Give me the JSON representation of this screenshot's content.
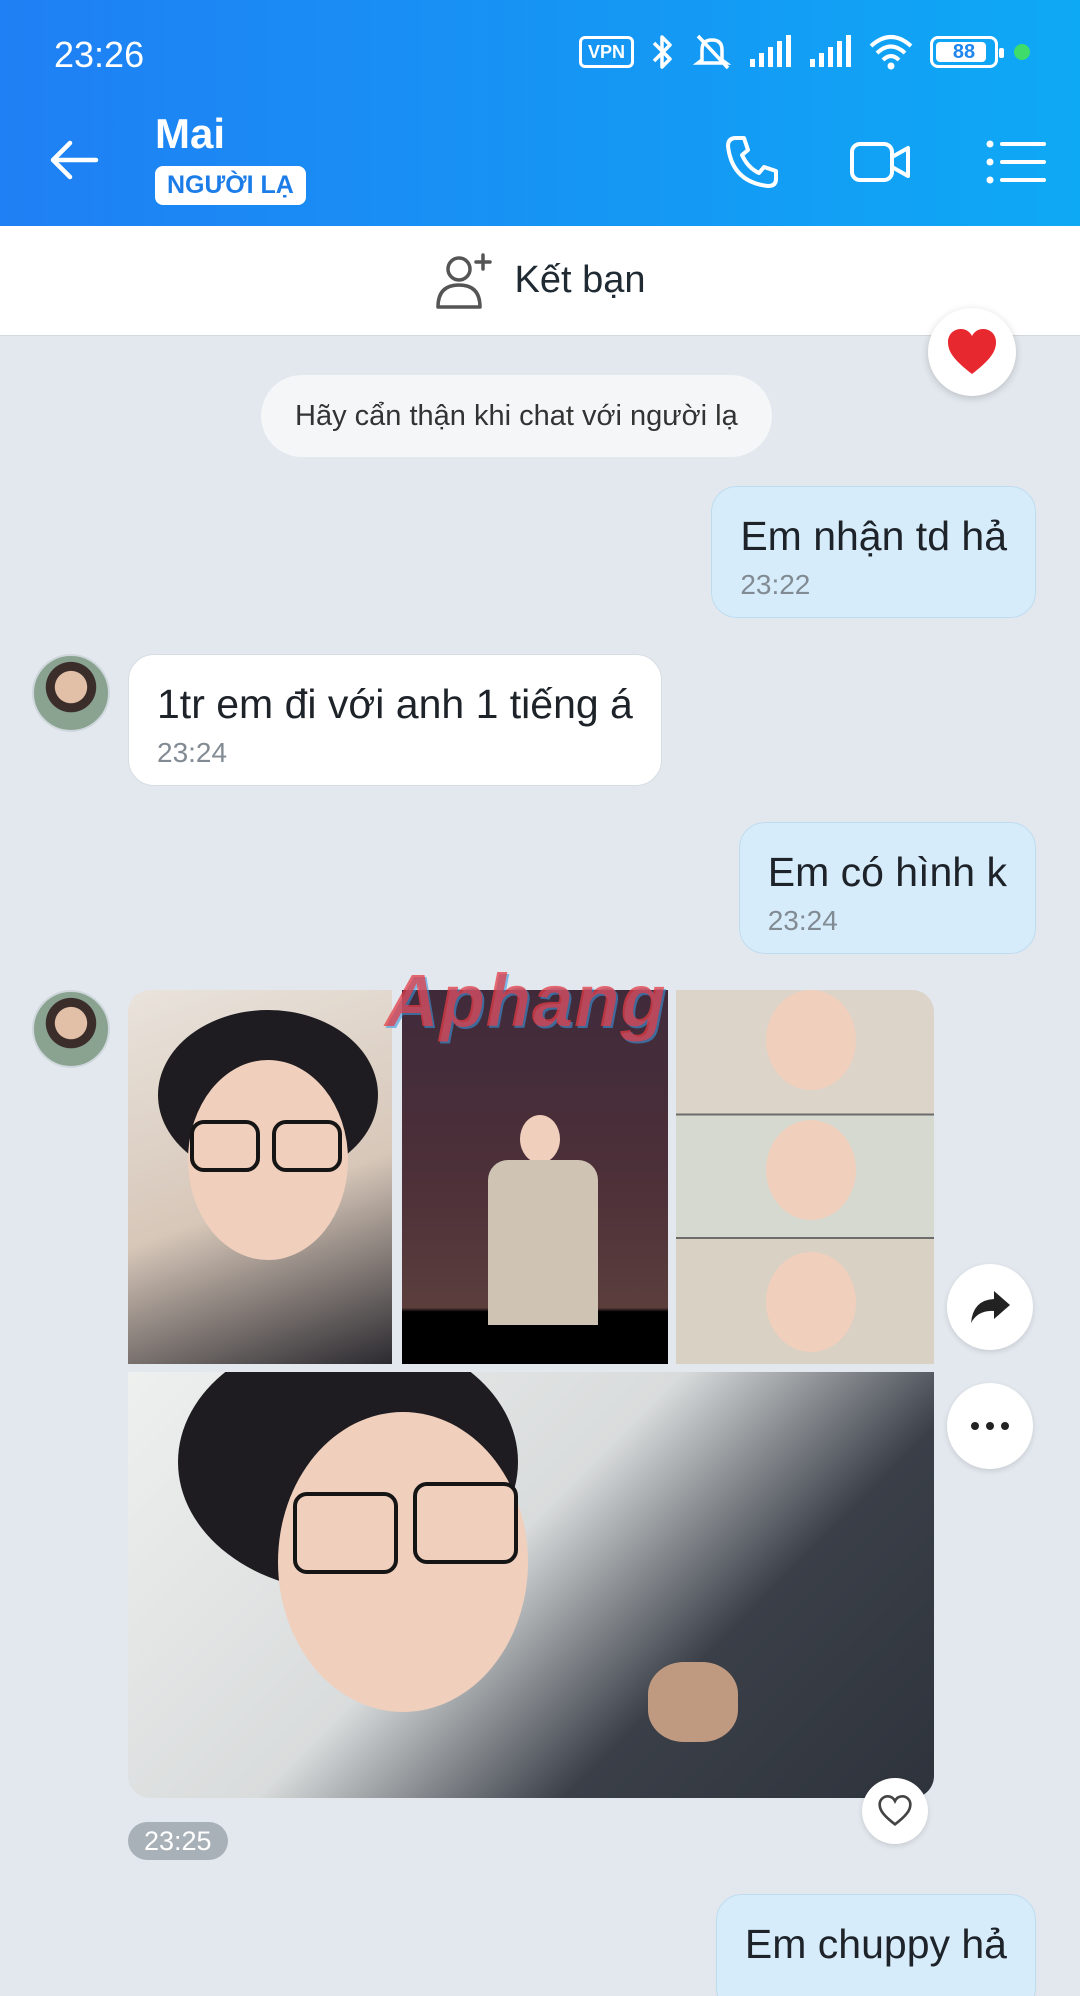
{
  "status_bar": {
    "time": "23:26",
    "vpn": "VPN",
    "battery": "88"
  },
  "header": {
    "contact_name": "Mai",
    "badge": "NGƯỜI LẠ",
    "icons": [
      "back-arrow-icon",
      "phone-icon",
      "video-camera-icon",
      "menu-list-icon"
    ]
  },
  "add_friend": {
    "label": "Kết bạn",
    "icon": "add-person-icon"
  },
  "system_note": "Hãy cẩn thận khi chat với người lạ",
  "messages": [
    {
      "side": "out",
      "text": "Em nhận td hả",
      "time": "23:22"
    },
    {
      "side": "in",
      "text": "1tr em đi với anh 1 tiếng á",
      "time": "23:24"
    },
    {
      "side": "out",
      "text": "Em có hình k",
      "time": "23:24"
    },
    {
      "side": "in",
      "type": "photos",
      "count": 4,
      "time": "23:25"
    },
    {
      "side": "out",
      "text": "Em chuppy hả"
    }
  ],
  "watermark": "Aphang",
  "colors": {
    "header_start": "#1f7ff4",
    "header_end": "#0ea9f5",
    "outgoing_bubble": "#d6ecfb",
    "background": "#e2e8ee"
  }
}
